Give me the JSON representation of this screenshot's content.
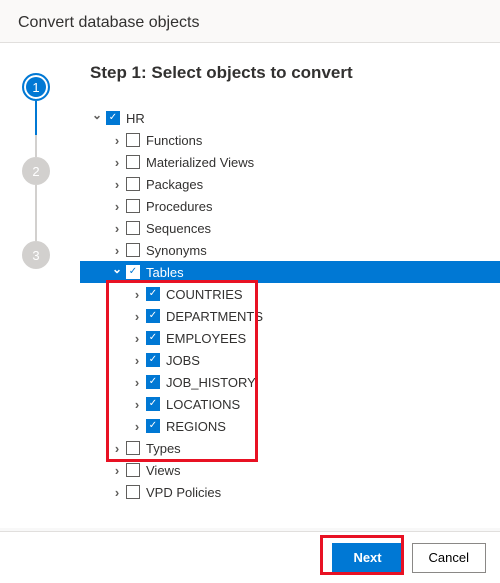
{
  "header": {
    "title": "Convert database objects"
  },
  "stepper": {
    "steps": [
      "1",
      "2",
      "3"
    ],
    "active": 0
  },
  "step": {
    "title": "Step 1: Select objects to convert"
  },
  "tree": {
    "root": {
      "label": "HR",
      "checked": true,
      "expanded": true
    },
    "groups": [
      {
        "label": "Functions",
        "checked": false
      },
      {
        "label": "Materialized Views",
        "checked": false
      },
      {
        "label": "Packages",
        "checked": false
      },
      {
        "label": "Procedures",
        "checked": false
      },
      {
        "label": "Sequences",
        "checked": false
      },
      {
        "label": "Synonyms",
        "checked": false
      }
    ],
    "tables": {
      "label": "Tables",
      "checked": true,
      "selected": true,
      "items": [
        {
          "label": "COUNTRIES",
          "checked": true
        },
        {
          "label": "DEPARTMENTS",
          "checked": true
        },
        {
          "label": "EMPLOYEES",
          "checked": true
        },
        {
          "label": "JOBS",
          "checked": true
        },
        {
          "label": "JOB_HISTORY",
          "checked": true
        },
        {
          "label": "LOCATIONS",
          "checked": true
        },
        {
          "label": "REGIONS",
          "checked": true
        }
      ]
    },
    "groups_after": [
      {
        "label": "Types",
        "checked": false
      },
      {
        "label": "Views",
        "checked": false
      },
      {
        "label": "VPD Policies",
        "checked": false
      }
    ]
  },
  "footer": {
    "next": "Next",
    "cancel": "Cancel"
  }
}
